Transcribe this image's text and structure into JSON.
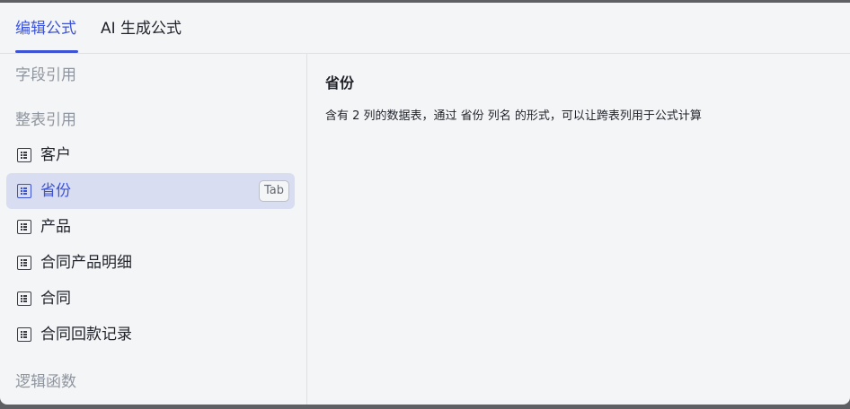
{
  "tabs": [
    {
      "label": "编辑公式",
      "active": true
    },
    {
      "label": "AI 生成公式",
      "active": false
    }
  ],
  "sidebar": {
    "field_ref_title": "字段引用",
    "table_ref_title": "整表引用",
    "tables": [
      {
        "label": "客户"
      },
      {
        "label": "省份",
        "selected": true,
        "shortcut": "Tab"
      },
      {
        "label": "产品"
      },
      {
        "label": "合同产品明细"
      },
      {
        "label": "合同"
      },
      {
        "label": "合同回款记录"
      }
    ],
    "logic_title": "逻辑函数"
  },
  "detail": {
    "title": "省份",
    "description": "含有 2 列的数据表，通过 省份 列名 的形式，可以让跨表列用于公式计算"
  },
  "colors": {
    "accent": "#3c53d6",
    "selected_bg": "#d9ddf2",
    "muted_text": "#8f959e"
  }
}
